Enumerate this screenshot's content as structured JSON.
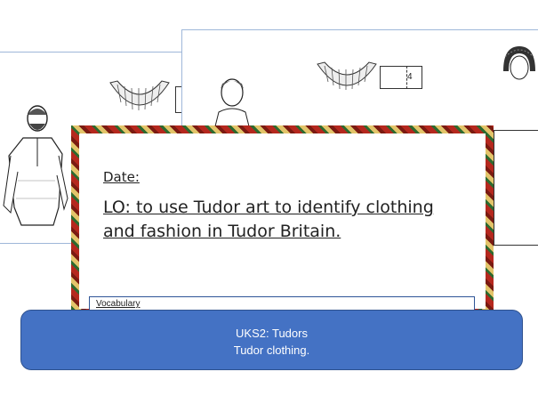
{
  "slide": {
    "date_label": "Date:",
    "learning_objective": "LO: to use Tudor art to identify clothing and fashion in Tudor Britain.",
    "vocabulary_label": "Vocabulary"
  },
  "background_sheets": {
    "table_number": "4"
  },
  "banner": {
    "line1": "UKS2: Tudors",
    "line2": "Tudor clothing."
  },
  "colors": {
    "banner_fill": "#4472c4",
    "frame_red": "#b5281e",
    "frame_green": "#2d6a2f",
    "frame_gold": "#e3c46a"
  }
}
